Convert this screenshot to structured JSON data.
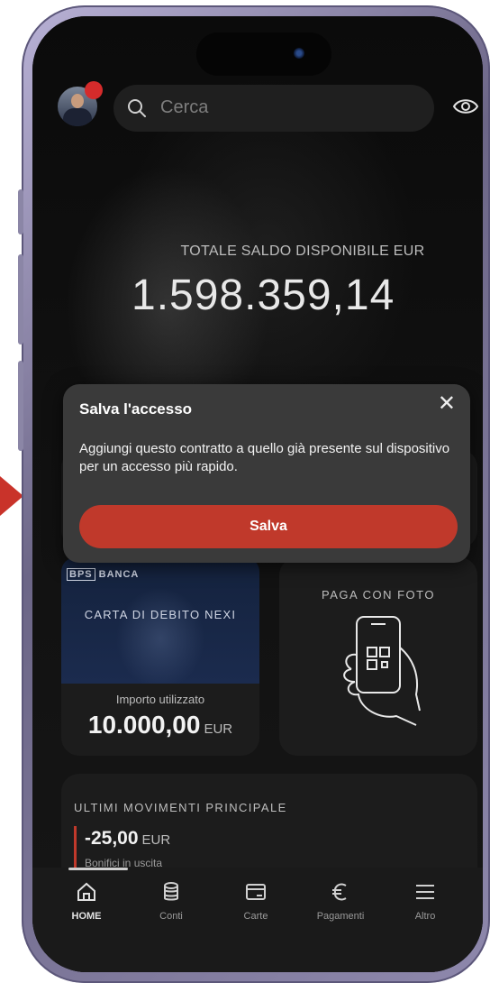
{
  "search": {
    "placeholder": "Cerca"
  },
  "balance": {
    "label": "TOTALE SALDO DISPONIBILE EUR",
    "value": "1.598.359,14"
  },
  "dialog": {
    "title": "Salva l'accesso",
    "close": "✕",
    "message": "Aggiungi questo contratto a quello già presente sul dispositivo per un accesso più rapido.",
    "button": "Salva"
  },
  "debit_card": {
    "title": "CARTA DI DEBITO NEXI",
    "used_label": "Importo utilizzato",
    "used_value": "10.000,00",
    "currency": "EUR"
  },
  "photo_pay": {
    "label": "PAGA CON FOTO"
  },
  "movements": {
    "title": "ULTIMI MOVIMENTI PRINCIPALE",
    "amount": "-25,00",
    "currency": "EUR",
    "description": "Bonifici in uscita"
  },
  "tabs": [
    {
      "label": "HOME",
      "icon": "home-icon"
    },
    {
      "label": "Conti",
      "icon": "database-icon"
    },
    {
      "label": "Carte",
      "icon": "card-icon"
    },
    {
      "label": "Pagamenti",
      "icon": "euro-icon"
    },
    {
      "label": "Altro",
      "icon": "menu-icon"
    }
  ],
  "colors": {
    "accent": "#c0392b",
    "background": "#000000",
    "surface": "#1c1c1c",
    "dialog": "#3a3a3a"
  }
}
